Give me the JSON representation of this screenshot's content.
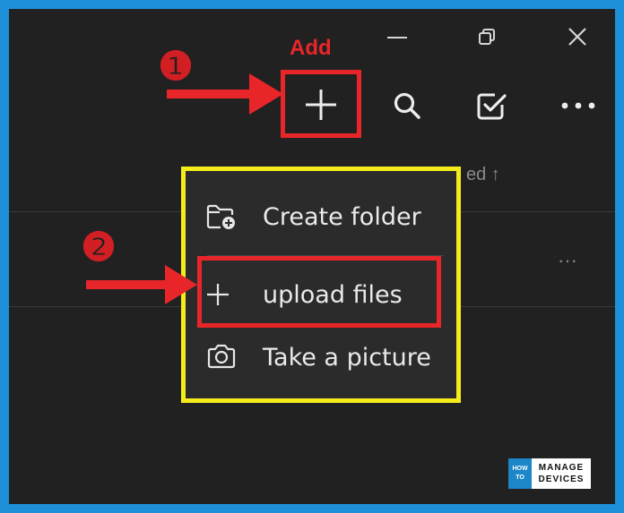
{
  "titlebar": {
    "minimize": "minimize-icon",
    "restore": "restore-icon",
    "close": "close-icon"
  },
  "toolbar": {
    "add": "plus-icon",
    "search": "search-icon",
    "select": "checkbox-icon",
    "more": "more-icon"
  },
  "column_header": {
    "partial_text": "ed ↑"
  },
  "row": {
    "more_label": "···"
  },
  "menu": {
    "items": [
      {
        "label": "Create folder",
        "icon": "folder-add-icon"
      },
      {
        "label": "upload files",
        "icon": "plus-icon"
      },
      {
        "label": "Take a picture",
        "icon": "camera-icon"
      }
    ]
  },
  "annotations": {
    "add_label": "Add",
    "step1": "❶",
    "step2": "❷"
  },
  "logo": {
    "how": "HOW",
    "to": "TO",
    "manage": "MANAGE",
    "devices": "DEVICES"
  },
  "colors": {
    "frame_border": "#1e90d9",
    "background": "#212121",
    "menu_bg": "#2b2b2b",
    "highlight_yellow": "#f5ec1b",
    "callout_red": "#e8262a"
  }
}
